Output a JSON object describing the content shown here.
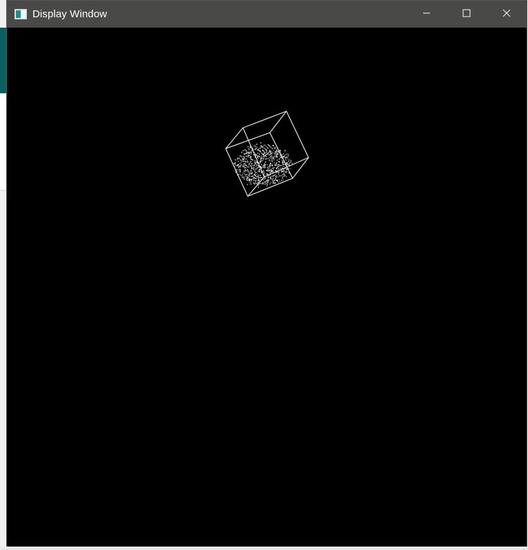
{
  "window": {
    "title": "Display Window",
    "icons": {
      "app": "app-window-icon",
      "minimize": "minimize-icon",
      "maximize": "maximize-icon",
      "close": "close-icon"
    }
  },
  "viewport": {
    "background": "#000000",
    "object": "wireframe-cube-with-point-cloud",
    "line_color": "#e6e6e6"
  },
  "colors": {
    "titlebar": "#494948",
    "title_text": "#ffffff"
  }
}
